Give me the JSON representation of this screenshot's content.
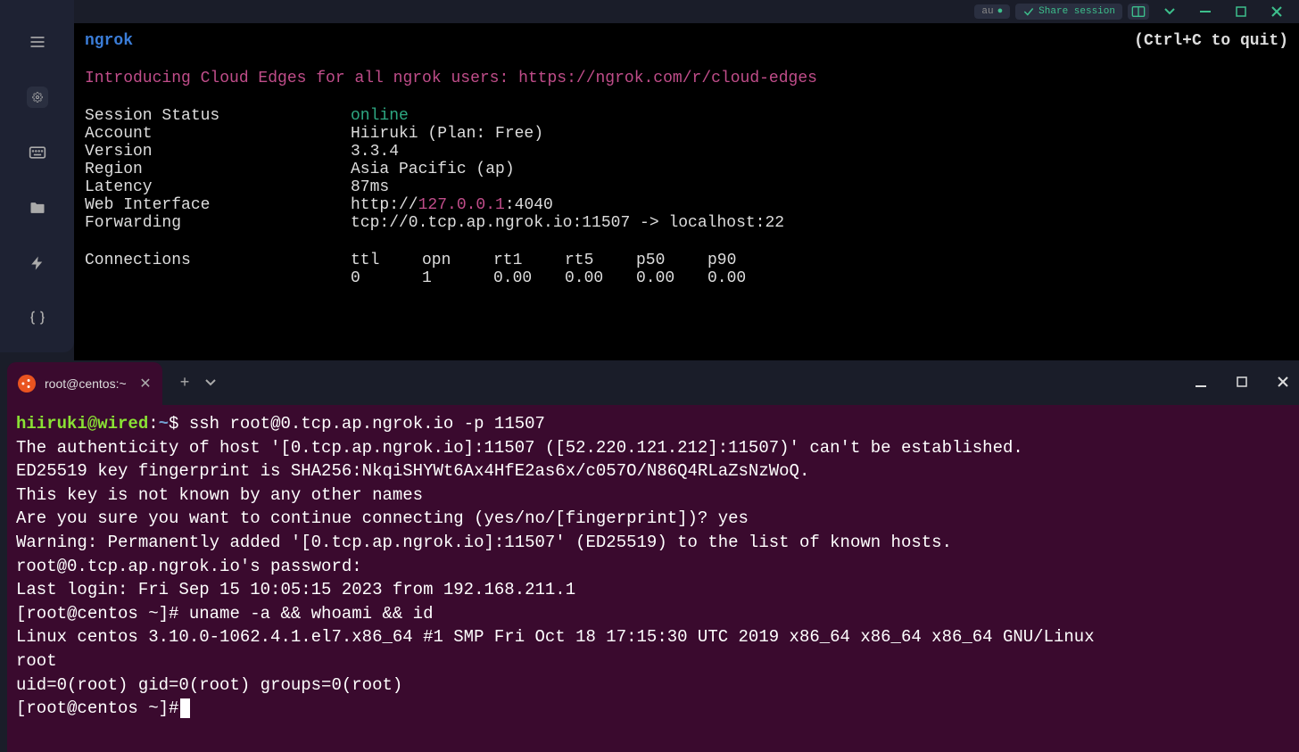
{
  "topbar": {
    "au_label": "au",
    "share_label": "Share session"
  },
  "ngrok": {
    "title": "ngrok",
    "quit_hint": "(Ctrl+C to quit)",
    "intro": "Introducing Cloud Edges for all ngrok users: https://ngrok.com/r/cloud-edges",
    "session_status_label": "Session Status",
    "session_status_value": "online",
    "account_label": "Account",
    "account_value": "Hiiruki (Plan: Free)",
    "version_label": "Version",
    "version_value": "3.3.4",
    "region_label": "Region",
    "region_value": "Asia Pacific (ap)",
    "latency_label": "Latency",
    "latency_value": "87ms",
    "web_label": "Web Interface",
    "web_prefix": "http://",
    "web_ip": "127.0.0.1",
    "web_suffix": ":4040",
    "forwarding_label": "Forwarding",
    "forwarding_value": "tcp://0.tcp.ap.ngrok.io:11507 -> localhost:22",
    "connections_label": "Connections",
    "headers": {
      "ttl": "ttl",
      "opn": "opn",
      "rt1": "rt1",
      "rt5": "rt5",
      "p50": "p50",
      "p90": "p90"
    },
    "values": {
      "ttl": "0",
      "opn": "1",
      "rt1": "0.00",
      "rt5": "0.00",
      "p50": "0.00",
      "p90": "0.00"
    }
  },
  "tab": {
    "title": "root@centos:~"
  },
  "term": {
    "prompt_user": "hiiruki@wired",
    "prompt_colon": ":",
    "prompt_path": "~",
    "prompt_dollar": "$ ",
    "cmd1": "ssh root@0.tcp.ap.ngrok.io -p 11507",
    "line1": "The authenticity of host '[0.tcp.ap.ngrok.io]:11507 ([52.220.121.212]:11507)' can't be established.",
    "line2": "ED25519 key fingerprint is SHA256:NkqiSHYWt6Ax4HfE2as6x/c057O/N86Q4RLaZsNzWoQ.",
    "line3": "This key is not known by any other names",
    "line4": "Are you sure you want to continue connecting (yes/no/[fingerprint])? yes",
    "line5": "Warning: Permanently added '[0.tcp.ap.ngrok.io]:11507' (ED25519) to the list of known hosts.",
    "line6": "root@0.tcp.ap.ngrok.io's password:",
    "line7": "Last login: Fri Sep 15 10:05:15 2023 from 192.168.211.1",
    "line8": "[root@centos ~]# uname -a && whoami && id",
    "line9": "Linux centos 3.10.0-1062.4.1.el7.x86_64 #1 SMP Fri Oct 18 17:15:30 UTC 2019 x86_64 x86_64 x86_64 GNU/Linux",
    "line10": "root",
    "line11": "uid=0(root) gid=0(root) groups=0(root)",
    "line12": "[root@centos ~]#"
  }
}
